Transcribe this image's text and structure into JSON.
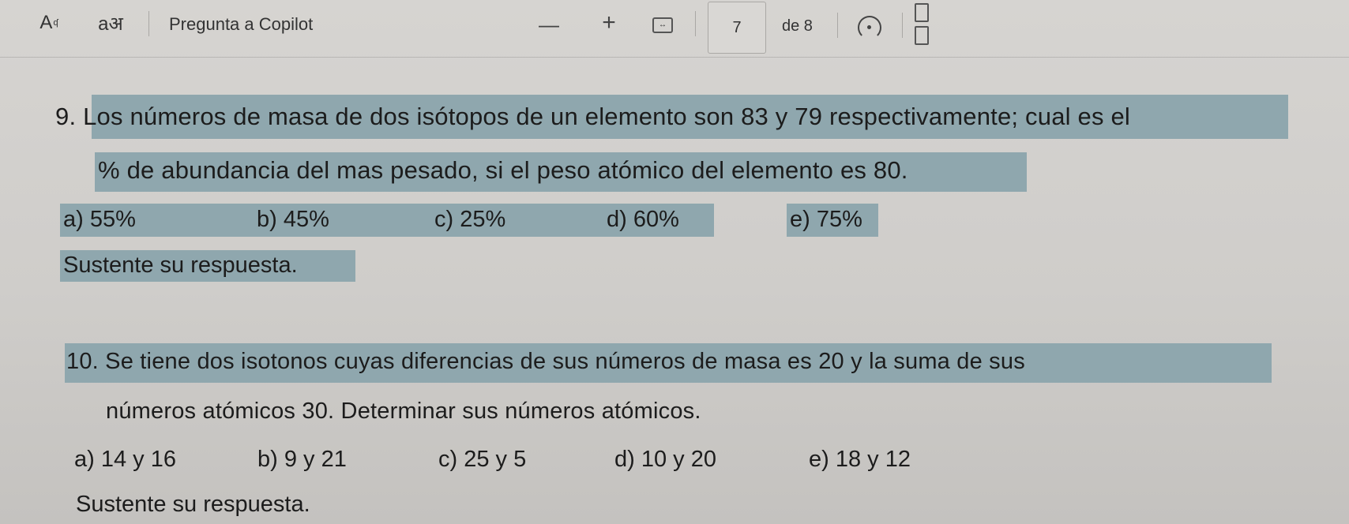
{
  "toolbar": {
    "read_aloud_icon": "A",
    "read_aloud_sup": "ʠ",
    "translate_icon": "aअ",
    "copilot_label": "Pregunta a Copilot",
    "zoom_out": "—",
    "zoom_in": "+",
    "fit_icon": "↔",
    "page_current": "7",
    "page_total": "de 8"
  },
  "question9": {
    "line1": "9. Los números de masa de dos isótopos de un elemento son 83 y 79 respectivamente; cual es el",
    "line2": "% de abundancia del mas pesado, si el peso atómico del elemento es 80.",
    "options": {
      "a": "a) 55%",
      "b": "b) 45%",
      "c": "c) 25%",
      "d": "d) 60%",
      "e": "e) 75%"
    },
    "sustente": "Sustente su respuesta."
  },
  "question10": {
    "line1": "10. Se tiene dos isotonos cuyas diferencias de sus números de masa es 20 y la suma de sus",
    "line2": "números atómicos 30. Determinar sus números atómicos.",
    "options": {
      "a": "a) 14 y 16",
      "b": "b) 9 y 21",
      "c": "c) 25 y 5",
      "d": "d) 10 y 20",
      "e": "e) 18 y 12"
    },
    "sustente": "Sustente su respuesta."
  },
  "colors": {
    "highlight": "#8fa7ae",
    "background": "#d3d1ce"
  }
}
